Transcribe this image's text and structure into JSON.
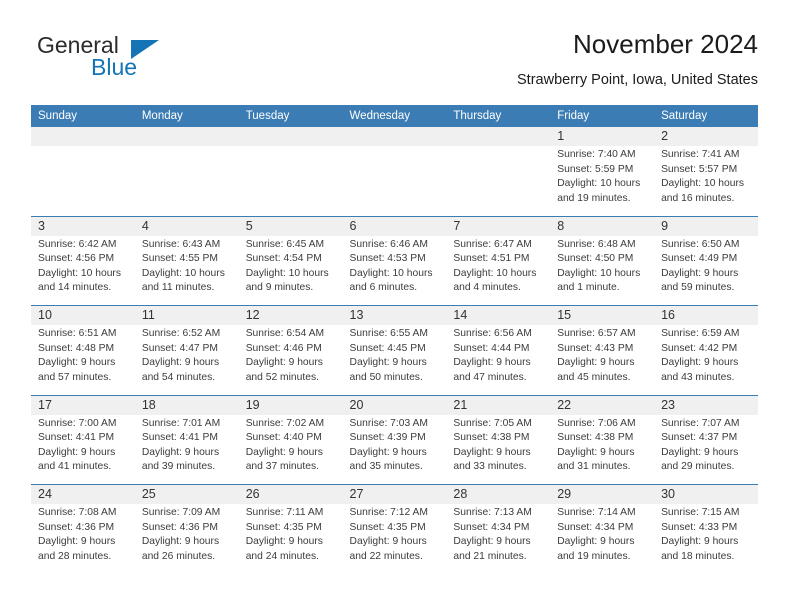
{
  "logo": {
    "word1": "General",
    "word2": "Blue",
    "triangle_color": "#1574b5"
  },
  "header": {
    "title": "November 2024",
    "subtitle": "Strawberry Point, Iowa, United States"
  },
  "theme": {
    "header_blue": "#3b7cb5",
    "daynum_gray": "#f0f0f0",
    "text": "#3c3c3c"
  },
  "calendar": {
    "weekday_headers": [
      "Sunday",
      "Monday",
      "Tuesday",
      "Wednesday",
      "Thursday",
      "Friday",
      "Saturday"
    ],
    "weeks": [
      [
        {
          "day": "",
          "sunrise": "",
          "sunset": "",
          "daylight_1": "",
          "daylight_2": ""
        },
        {
          "day": "",
          "sunrise": "",
          "sunset": "",
          "daylight_1": "",
          "daylight_2": ""
        },
        {
          "day": "",
          "sunrise": "",
          "sunset": "",
          "daylight_1": "",
          "daylight_2": ""
        },
        {
          "day": "",
          "sunrise": "",
          "sunset": "",
          "daylight_1": "",
          "daylight_2": ""
        },
        {
          "day": "",
          "sunrise": "",
          "sunset": "",
          "daylight_1": "",
          "daylight_2": ""
        },
        {
          "day": "1",
          "sunrise": "Sunrise: 7:40 AM",
          "sunset": "Sunset: 5:59 PM",
          "daylight_1": "Daylight: 10 hours",
          "daylight_2": "and 19 minutes."
        },
        {
          "day": "2",
          "sunrise": "Sunrise: 7:41 AM",
          "sunset": "Sunset: 5:57 PM",
          "daylight_1": "Daylight: 10 hours",
          "daylight_2": "and 16 minutes."
        }
      ],
      [
        {
          "day": "3",
          "sunrise": "Sunrise: 6:42 AM",
          "sunset": "Sunset: 4:56 PM",
          "daylight_1": "Daylight: 10 hours",
          "daylight_2": "and 14 minutes."
        },
        {
          "day": "4",
          "sunrise": "Sunrise: 6:43 AM",
          "sunset": "Sunset: 4:55 PM",
          "daylight_1": "Daylight: 10 hours",
          "daylight_2": "and 11 minutes."
        },
        {
          "day": "5",
          "sunrise": "Sunrise: 6:45 AM",
          "sunset": "Sunset: 4:54 PM",
          "daylight_1": "Daylight: 10 hours",
          "daylight_2": "and 9 minutes."
        },
        {
          "day": "6",
          "sunrise": "Sunrise: 6:46 AM",
          "sunset": "Sunset: 4:53 PM",
          "daylight_1": "Daylight: 10 hours",
          "daylight_2": "and 6 minutes."
        },
        {
          "day": "7",
          "sunrise": "Sunrise: 6:47 AM",
          "sunset": "Sunset: 4:51 PM",
          "daylight_1": "Daylight: 10 hours",
          "daylight_2": "and 4 minutes."
        },
        {
          "day": "8",
          "sunrise": "Sunrise: 6:48 AM",
          "sunset": "Sunset: 4:50 PM",
          "daylight_1": "Daylight: 10 hours",
          "daylight_2": "and 1 minute."
        },
        {
          "day": "9",
          "sunrise": "Sunrise: 6:50 AM",
          "sunset": "Sunset: 4:49 PM",
          "daylight_1": "Daylight: 9 hours",
          "daylight_2": "and 59 minutes."
        }
      ],
      [
        {
          "day": "10",
          "sunrise": "Sunrise: 6:51 AM",
          "sunset": "Sunset: 4:48 PM",
          "daylight_1": "Daylight: 9 hours",
          "daylight_2": "and 57 minutes."
        },
        {
          "day": "11",
          "sunrise": "Sunrise: 6:52 AM",
          "sunset": "Sunset: 4:47 PM",
          "daylight_1": "Daylight: 9 hours",
          "daylight_2": "and 54 minutes."
        },
        {
          "day": "12",
          "sunrise": "Sunrise: 6:54 AM",
          "sunset": "Sunset: 4:46 PM",
          "daylight_1": "Daylight: 9 hours",
          "daylight_2": "and 52 minutes."
        },
        {
          "day": "13",
          "sunrise": "Sunrise: 6:55 AM",
          "sunset": "Sunset: 4:45 PM",
          "daylight_1": "Daylight: 9 hours",
          "daylight_2": "and 50 minutes."
        },
        {
          "day": "14",
          "sunrise": "Sunrise: 6:56 AM",
          "sunset": "Sunset: 4:44 PM",
          "daylight_1": "Daylight: 9 hours",
          "daylight_2": "and 47 minutes."
        },
        {
          "day": "15",
          "sunrise": "Sunrise: 6:57 AM",
          "sunset": "Sunset: 4:43 PM",
          "daylight_1": "Daylight: 9 hours",
          "daylight_2": "and 45 minutes."
        },
        {
          "day": "16",
          "sunrise": "Sunrise: 6:59 AM",
          "sunset": "Sunset: 4:42 PM",
          "daylight_1": "Daylight: 9 hours",
          "daylight_2": "and 43 minutes."
        }
      ],
      [
        {
          "day": "17",
          "sunrise": "Sunrise: 7:00 AM",
          "sunset": "Sunset: 4:41 PM",
          "daylight_1": "Daylight: 9 hours",
          "daylight_2": "and 41 minutes."
        },
        {
          "day": "18",
          "sunrise": "Sunrise: 7:01 AM",
          "sunset": "Sunset: 4:41 PM",
          "daylight_1": "Daylight: 9 hours",
          "daylight_2": "and 39 minutes."
        },
        {
          "day": "19",
          "sunrise": "Sunrise: 7:02 AM",
          "sunset": "Sunset: 4:40 PM",
          "daylight_1": "Daylight: 9 hours",
          "daylight_2": "and 37 minutes."
        },
        {
          "day": "20",
          "sunrise": "Sunrise: 7:03 AM",
          "sunset": "Sunset: 4:39 PM",
          "daylight_1": "Daylight: 9 hours",
          "daylight_2": "and 35 minutes."
        },
        {
          "day": "21",
          "sunrise": "Sunrise: 7:05 AM",
          "sunset": "Sunset: 4:38 PM",
          "daylight_1": "Daylight: 9 hours",
          "daylight_2": "and 33 minutes."
        },
        {
          "day": "22",
          "sunrise": "Sunrise: 7:06 AM",
          "sunset": "Sunset: 4:38 PM",
          "daylight_1": "Daylight: 9 hours",
          "daylight_2": "and 31 minutes."
        },
        {
          "day": "23",
          "sunrise": "Sunrise: 7:07 AM",
          "sunset": "Sunset: 4:37 PM",
          "daylight_1": "Daylight: 9 hours",
          "daylight_2": "and 29 minutes."
        }
      ],
      [
        {
          "day": "24",
          "sunrise": "Sunrise: 7:08 AM",
          "sunset": "Sunset: 4:36 PM",
          "daylight_1": "Daylight: 9 hours",
          "daylight_2": "and 28 minutes."
        },
        {
          "day": "25",
          "sunrise": "Sunrise: 7:09 AM",
          "sunset": "Sunset: 4:36 PM",
          "daylight_1": "Daylight: 9 hours",
          "daylight_2": "and 26 minutes."
        },
        {
          "day": "26",
          "sunrise": "Sunrise: 7:11 AM",
          "sunset": "Sunset: 4:35 PM",
          "daylight_1": "Daylight: 9 hours",
          "daylight_2": "and 24 minutes."
        },
        {
          "day": "27",
          "sunrise": "Sunrise: 7:12 AM",
          "sunset": "Sunset: 4:35 PM",
          "daylight_1": "Daylight: 9 hours",
          "daylight_2": "and 22 minutes."
        },
        {
          "day": "28",
          "sunrise": "Sunrise: 7:13 AM",
          "sunset": "Sunset: 4:34 PM",
          "daylight_1": "Daylight: 9 hours",
          "daylight_2": "and 21 minutes."
        },
        {
          "day": "29",
          "sunrise": "Sunrise: 7:14 AM",
          "sunset": "Sunset: 4:34 PM",
          "daylight_1": "Daylight: 9 hours",
          "daylight_2": "and 19 minutes."
        },
        {
          "day": "30",
          "sunrise": "Sunrise: 7:15 AM",
          "sunset": "Sunset: 4:33 PM",
          "daylight_1": "Daylight: 9 hours",
          "daylight_2": "and 18 minutes."
        }
      ]
    ]
  }
}
